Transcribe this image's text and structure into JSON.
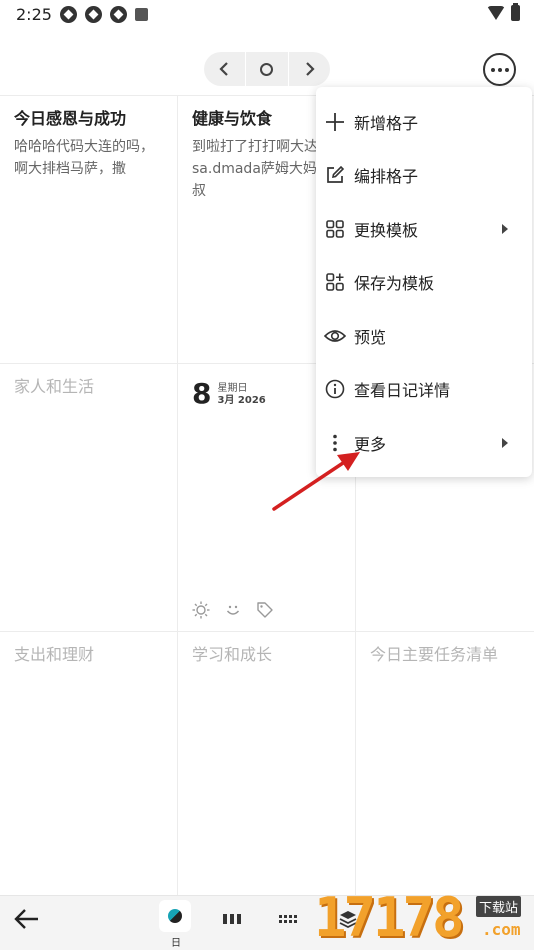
{
  "status_bar": {
    "time": "2:25"
  },
  "nav": {
    "prev": "‹",
    "next": "›"
  },
  "grid": {
    "cells": [
      {
        "title": "今日感恩与成功",
        "body": "哈哈哈代码大连的吗，啊大排档马萨，撒"
      },
      {
        "title": "健康与饮食",
        "body": "到啦打了打打啊大达sasa.dmada萨姆大妈大叔"
      },
      {
        "title": "家人和生活",
        "body": ""
      },
      {
        "title": "支出和理财",
        "body": ""
      },
      {
        "title": "学习和成长",
        "body": ""
      },
      {
        "title": "今日主要任务清单",
        "body": ""
      }
    ],
    "date": {
      "day": "8",
      "weekday": "星期日",
      "month_year": "3月 2026"
    }
  },
  "menu": {
    "items": [
      {
        "label": "新增格子",
        "icon": "plus-icon"
      },
      {
        "label": "编排格子",
        "icon": "edit-icon"
      },
      {
        "label": "更换模板",
        "icon": "grid-icon"
      },
      {
        "label": "保存为模板",
        "icon": "grid-add-icon"
      },
      {
        "label": "预览",
        "icon": "eye-icon"
      },
      {
        "label": "查看日记详情",
        "icon": "info-icon"
      },
      {
        "label": "更多",
        "icon": "more-vertical-icon"
      }
    ]
  },
  "bottom_bar": {
    "day_label": "日"
  },
  "watermark": {
    "number": "17178",
    "badge": "下载站",
    "domain": ".com"
  },
  "colors": {
    "accent": "#16a3b5",
    "annotation_arrow": "#d42020",
    "watermark": "#f2a12b"
  }
}
